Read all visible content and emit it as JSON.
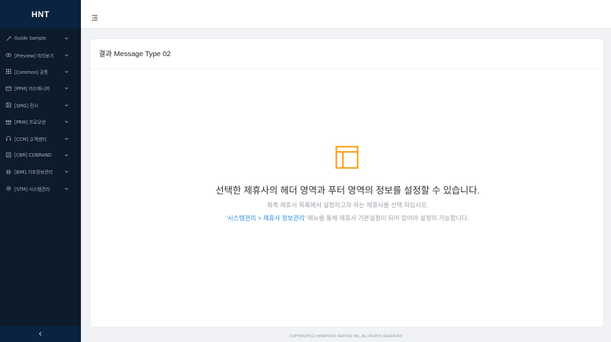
{
  "sidebar": {
    "brand": "HNT",
    "items": [
      {
        "icon": "guide-icon",
        "label": "Guide Sample"
      },
      {
        "icon": "preview-icon",
        "label": "[Preview] 미리보기"
      },
      {
        "icon": "common-icon",
        "label": "[Common] 공통"
      },
      {
        "icon": "card-icon",
        "label": "[PPM] 카드매니저"
      },
      {
        "icon": "display-icon",
        "label": "[SMG] 전시"
      },
      {
        "icon": "promotion-icon",
        "label": "[PRM] 프로모션"
      },
      {
        "icon": "headset-icon",
        "label": "[CCM] 고객센터"
      },
      {
        "icon": "cobrand-icon",
        "label": "[CBR] COBRAND"
      },
      {
        "icon": "hash-icon",
        "label": "[BIM] 기초정보관리"
      },
      {
        "icon": "settings-icon",
        "label": "[STM] 시스템관리"
      }
    ],
    "collapse_glyph": "‹"
  },
  "card": {
    "title": "결과 Message Type 02"
  },
  "message": {
    "title": "선택한 제휴사의 헤더 영역과 푸터 영역의 정보를 설정할 수 있습니다.",
    "subtitle": "좌측 제휴사 목록에서 설정하고자 하는 제휴사를 선택 하십시오.",
    "link_text": "'시스템관리 > 제휴사 정보관리'",
    "link_suffix": " 메뉴를 통해 제휴사 기본설정이 되어 있어야 설정이 가능합니다."
  },
  "footer": {
    "copyright": "COPYRIGHT(C) HANATOUR SERVICE INC. ALL RIGHTS RESERVED"
  },
  "colors": {
    "sidebar_bg": "#0e1b2c",
    "brand_bg": "#0a2340",
    "accent_orange": "#f5a623",
    "link_blue": "#2d8ce0"
  }
}
